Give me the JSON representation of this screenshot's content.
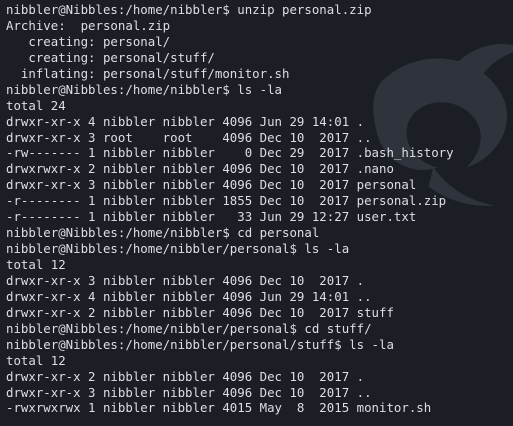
{
  "terminal": {
    "background": "#1b1e25",
    "foreground": "#dcdfe4",
    "watermark_icon": "kali-dragon-icon",
    "lines": [
      "nibbler@Nibbles:/home/nibbler$ unzip personal.zip",
      "Archive:  personal.zip",
      "   creating: personal/",
      "   creating: personal/stuff/",
      "  inflating: personal/stuff/monitor.sh",
      "nibbler@Nibbles:/home/nibbler$ ls -la",
      "total 24",
      "drwxr-xr-x 4 nibbler nibbler 4096 Jun 29 14:01 .",
      "drwxr-xr-x 3 root    root    4096 Dec 10  2017 ..",
      "-rw------- 1 nibbler nibbler    0 Dec 29  2017 .bash_history",
      "drwxrwxr-x 2 nibbler nibbler 4096 Dec 10  2017 .nano",
      "drwxr-xr-x 3 nibbler nibbler 4096 Dec 10  2017 personal",
      "-r-------- 1 nibbler nibbler 1855 Dec 10  2017 personal.zip",
      "-r-------- 1 nibbler nibbler   33 Jun 29 12:27 user.txt",
      "nibbler@Nibbles:/home/nibbler$ cd personal",
      "nibbler@Nibbles:/home/nibbler/personal$ ls -la",
      "total 12",
      "drwxr-xr-x 3 nibbler nibbler 4096 Dec 10  2017 .",
      "drwxr-xr-x 4 nibbler nibbler 4096 Jun 29 14:01 ..",
      "drwxr-xr-x 2 nibbler nibbler 4096 Dec 10  2017 stuff",
      "nibbler@Nibbles:/home/nibbler/personal$ cd stuff/",
      "nibbler@Nibbles:/home/nibbler/personal/stuff$ ls -la",
      "total 12",
      "drwxr-xr-x 2 nibbler nibbler 4096 Dec 10  2017 .",
      "drwxr-xr-x 3 nibbler nibbler 4096 Dec 10  2017 ..",
      "-rwxrwxrwx 1 nibbler nibbler 4015 May  8  2015 monitor.sh"
    ]
  }
}
